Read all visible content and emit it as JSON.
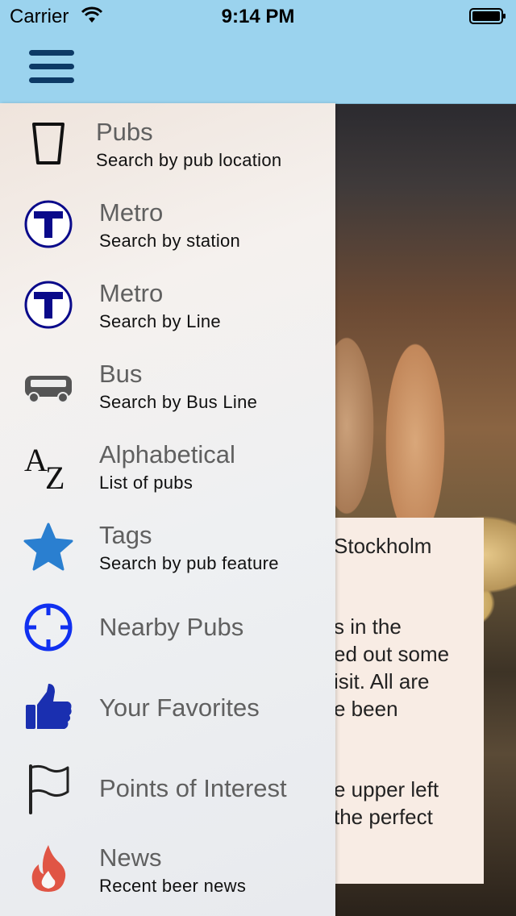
{
  "status_bar": {
    "carrier": "Carrier",
    "time": "9:14 PM"
  },
  "menu": {
    "items": [
      {
        "title": "Pubs",
        "subtitle": "Search by pub location",
        "icon": "pint-glass-icon"
      },
      {
        "title": "Metro",
        "subtitle": "Search by station",
        "icon": "metro-t-icon"
      },
      {
        "title": "Metro",
        "subtitle": "Search by Line",
        "icon": "metro-t-icon"
      },
      {
        "title": "Bus",
        "subtitle": "Search by Bus Line",
        "icon": "bus-icon"
      },
      {
        "title": "Alphabetical",
        "subtitle": "List of pubs",
        "icon": "az-icon"
      },
      {
        "title": "Tags",
        "subtitle": "Search by pub feature",
        "icon": "star-icon"
      },
      {
        "title": "Nearby Pubs",
        "icon": "crosshair-icon"
      },
      {
        "title": "Your Favorites",
        "icon": "thumbs-up-icon"
      },
      {
        "title": "Points of Interest",
        "icon": "flag-icon"
      },
      {
        "title": "News",
        "subtitle": "Recent beer news",
        "icon": "flame-icon"
      }
    ]
  },
  "content": {
    "lines": [
      "Stockholm",
      "s in the",
      "ed out some",
      "isit. All are",
      "e been",
      "e upper left",
      "the perfect"
    ]
  },
  "colors": {
    "header_bg": "#9bd3ee",
    "menu_icon": "#0d3a66",
    "metro_blue": "#0a0a8a",
    "star_blue": "#2a7fd0",
    "crosshair_blue": "#1030f0",
    "thumb_blue": "#1a2fb0",
    "flame_red": "#e05545"
  }
}
